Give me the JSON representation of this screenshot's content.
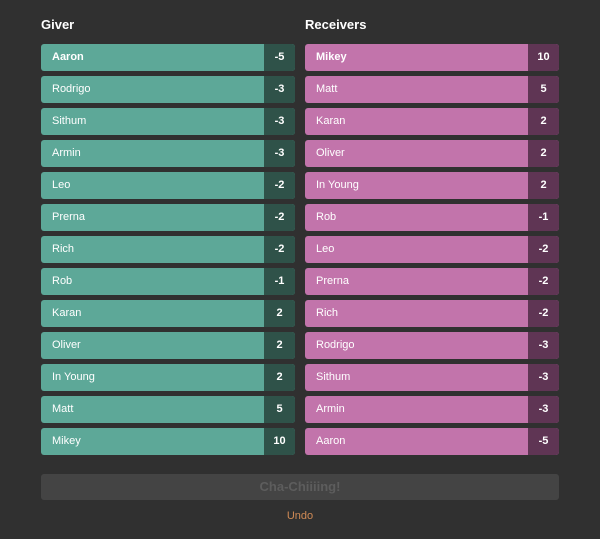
{
  "giver": {
    "title": "Giver",
    "items": [
      {
        "name": "Aaron",
        "score": "-5",
        "selected": true
      },
      {
        "name": "Rodrigo",
        "score": "-3"
      },
      {
        "name": "Sithum",
        "score": "-3"
      },
      {
        "name": "Armin",
        "score": "-3"
      },
      {
        "name": "Leo",
        "score": "-2"
      },
      {
        "name": "Prerna",
        "score": "-2"
      },
      {
        "name": "Rich",
        "score": "-2"
      },
      {
        "name": "Rob",
        "score": "-1"
      },
      {
        "name": "Karan",
        "score": "2"
      },
      {
        "name": "Oliver",
        "score": "2"
      },
      {
        "name": "In Young",
        "score": "2"
      },
      {
        "name": "Matt",
        "score": "5"
      },
      {
        "name": "Mikey",
        "score": "10"
      }
    ]
  },
  "receivers": {
    "title": "Receivers",
    "items": [
      {
        "name": "Mikey",
        "score": "10",
        "selected": true
      },
      {
        "name": "Matt",
        "score": "5"
      },
      {
        "name": "Karan",
        "score": "2"
      },
      {
        "name": "Oliver",
        "score": "2"
      },
      {
        "name": "In Young",
        "score": "2"
      },
      {
        "name": "Rob",
        "score": "-1"
      },
      {
        "name": "Leo",
        "score": "-2"
      },
      {
        "name": "Prerna",
        "score": "-2"
      },
      {
        "name": "Rich",
        "score": "-2"
      },
      {
        "name": "Rodrigo",
        "score": "-3"
      },
      {
        "name": "Sithum",
        "score": "-3"
      },
      {
        "name": "Armin",
        "score": "-3"
      },
      {
        "name": "Aaron",
        "score": "-5"
      }
    ]
  },
  "actions": {
    "submit_label": "Cha-Chiiiing!",
    "undo_label": "Undo"
  },
  "colors": {
    "giver_accent": "#5da898",
    "receiver_accent": "#c274ab",
    "undo": "#d08a55"
  }
}
